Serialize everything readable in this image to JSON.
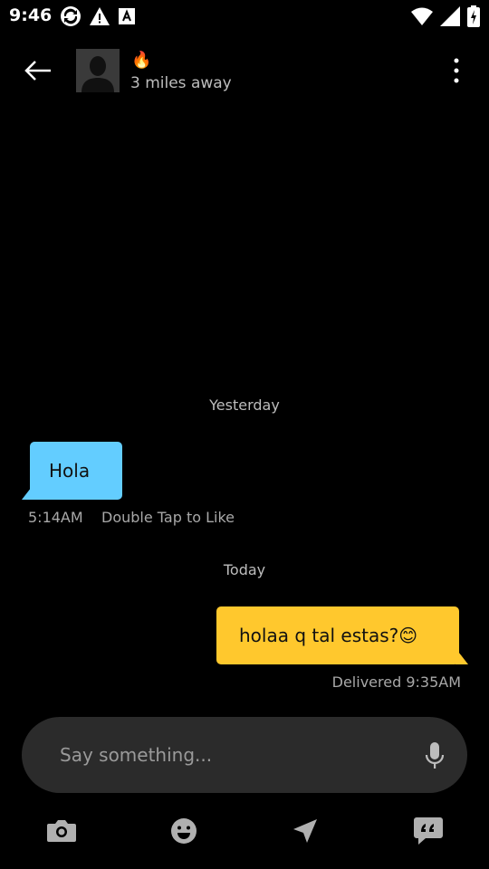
{
  "status_bar": {
    "time": "9:46",
    "icons_left": [
      "sync-icon",
      "warning-icon",
      "font-icon"
    ],
    "icons_right": [
      "wifi-icon",
      "signal-icon",
      "battery-icon"
    ]
  },
  "header": {
    "profile_emoji": "🔥",
    "distance": "3 miles away"
  },
  "conversation": {
    "yesterday_label": "Yesterday",
    "incoming": {
      "text": "Hola",
      "time": "5:14AM",
      "hint": "Double Tap to Like",
      "color": "#63cdff"
    },
    "today_label": "Today",
    "outgoing": {
      "text": "holaa q tal estas?😊",
      "status": "Delivered 9:35AM",
      "color": "#ffc82d"
    }
  },
  "composer": {
    "placeholder": "Say something..."
  },
  "actions": [
    "camera-icon",
    "emoji-icon",
    "location-icon",
    "quote-icon"
  ]
}
